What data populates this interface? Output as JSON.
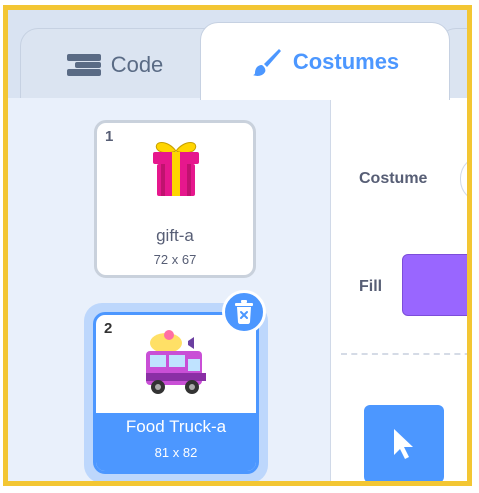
{
  "tabs": {
    "code": {
      "label": "Code",
      "icon": "code-blocks-icon"
    },
    "costumes": {
      "label": "Costumes",
      "icon": "paintbrush-icon",
      "active": true
    }
  },
  "costumes": [
    {
      "number": "1",
      "name": "gift-a",
      "size": "72 x 67",
      "selected": false,
      "thumbnail": "gift-icon"
    },
    {
      "number": "2",
      "name": "Food Truck-a",
      "size": "81 x 82",
      "selected": true,
      "thumbnail": "food-truck-icon"
    }
  ],
  "editor": {
    "costume_label": "Costume",
    "fill_label": "Fill",
    "fill_color": "#9966ff",
    "selected_tool": "select-arrow-icon"
  },
  "colors": {
    "accent": "#4c97ff",
    "highlight_border": "#f3c633",
    "sidebar_bg": "#e9f0fb",
    "text": "#575e75"
  }
}
